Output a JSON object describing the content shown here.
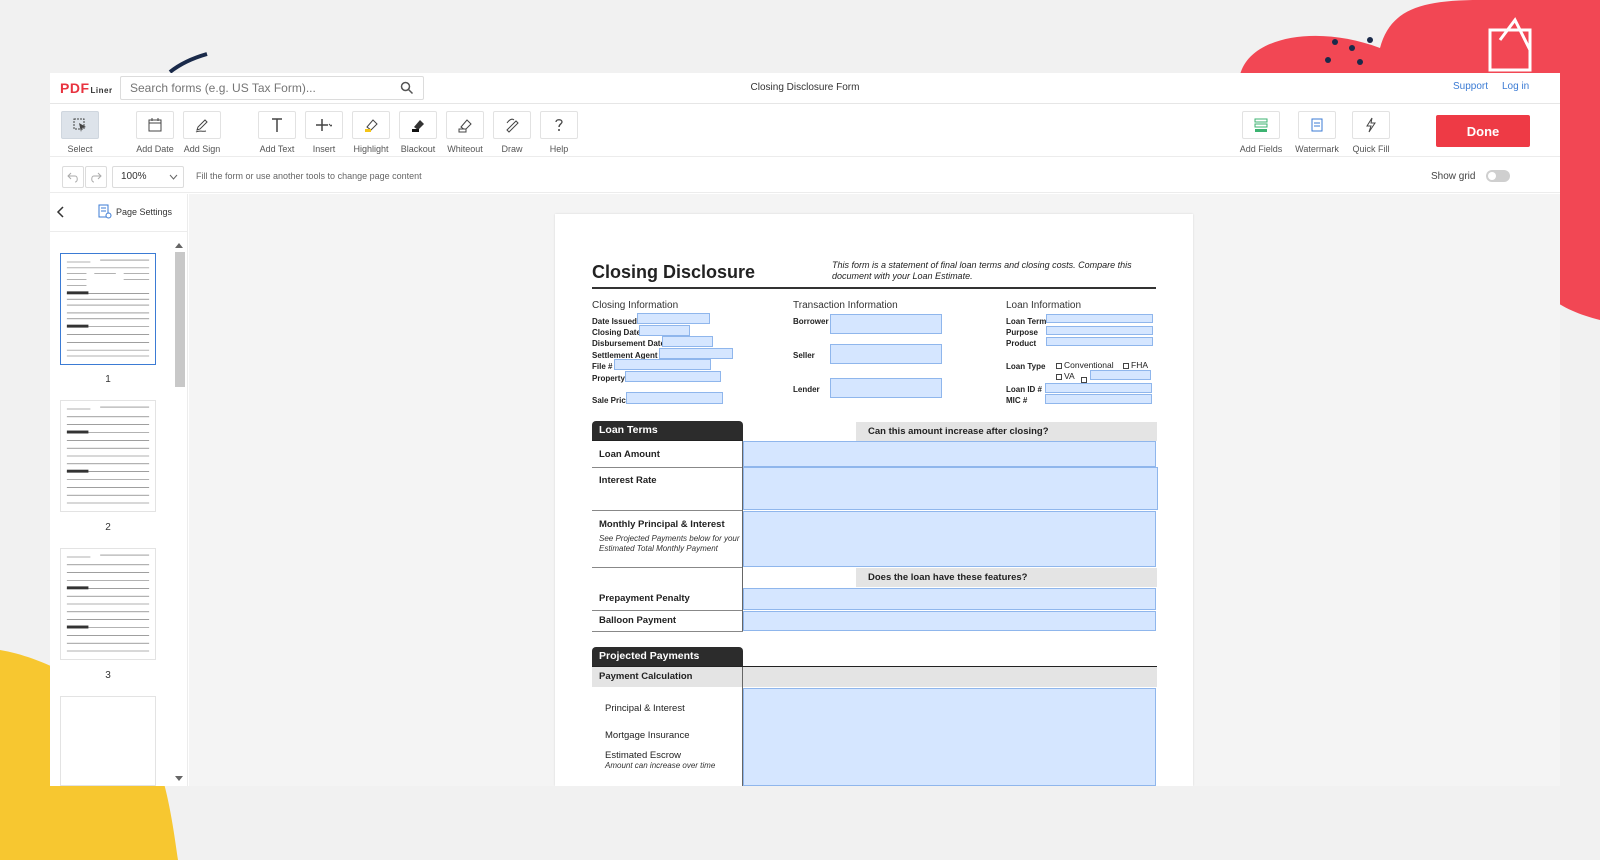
{
  "app": {
    "logo_main": "PDF",
    "logo_sub": "Liner",
    "search_placeholder": "Search forms (e.g. US Tax Form)...",
    "document_title": "Closing Disclosure Form",
    "support_label": "Support",
    "login_label": "Log in"
  },
  "toolbar": {
    "tools": [
      {
        "label": "Select",
        "icon": "cursor-icon"
      },
      {
        "label": "Add Date",
        "icon": "calendar-icon"
      },
      {
        "label": "Add Sign",
        "icon": "pen-icon"
      },
      {
        "label": "Add Text",
        "icon": "text-icon"
      },
      {
        "label": "Insert",
        "icon": "plus-icon"
      },
      {
        "label": "Highlight",
        "icon": "highlighter-icon"
      },
      {
        "label": "Blackout",
        "icon": "blackout-icon"
      },
      {
        "label": "Whiteout",
        "icon": "eraser-icon"
      },
      {
        "label": "Draw",
        "icon": "draw-icon"
      },
      {
        "label": "Help",
        "icon": "help-icon"
      }
    ],
    "right_tools": [
      {
        "label": "Add Fields",
        "icon": "fields-icon"
      },
      {
        "label": "Watermark",
        "icon": "watermark-icon"
      },
      {
        "label": "Quick Fill",
        "icon": "lightning-icon"
      }
    ],
    "done_label": "Done"
  },
  "subbar": {
    "zoom": "100%",
    "hint": "Fill the form or use another tools to change page content",
    "show_grid_label": "Show grid",
    "show_grid_on": false
  },
  "sidebar": {
    "page_settings_label": "Page Settings",
    "pages": [
      "1",
      "2",
      "3"
    ],
    "selected_page": "1"
  },
  "form": {
    "title": "Closing Disclosure",
    "intro": "This form is a statement of final loan terms and closing costs. Compare this document with your Loan Estimate.",
    "closing_info": {
      "heading": "Closing  Information",
      "fields": [
        "Date Issued",
        "Closing Date",
        "Disbursement Date",
        "Settlement Agent",
        "File #",
        "Property",
        "Sale Price"
      ]
    },
    "transaction_info": {
      "heading": "Transaction  Information",
      "fields": [
        "Borrower",
        "Seller",
        "Lender"
      ]
    },
    "loan_info": {
      "heading": "Loan  Information",
      "fields": [
        "Loan Term",
        "Purpose",
        "Product"
      ],
      "loan_type_label": "Loan Type",
      "loan_type_options": [
        "Conventional",
        "FHA",
        "VA"
      ],
      "id_fields": [
        "Loan ID #",
        "MIC #"
      ]
    },
    "loan_terms": {
      "heading": "Loan Terms",
      "question": "Can this amount increase after closing?",
      "rows": [
        "Loan Amount",
        "Interest Rate",
        "Monthly Principal & Interest"
      ],
      "monthly_note": "See Projected Payments below for your Estimated Total Monthly Payment",
      "features_question": "Does the loan have these features?",
      "feature_rows": [
        "Prepayment Penalty",
        "Balloon Payment"
      ]
    },
    "projected_payments": {
      "heading": "Projected Payments",
      "calc_label": "Payment Calculation",
      "rows": [
        "Principal & Interest",
        "Mortgage Insurance",
        "Estimated Escrow"
      ],
      "escrow_note": "Amount can increase over time"
    }
  }
}
